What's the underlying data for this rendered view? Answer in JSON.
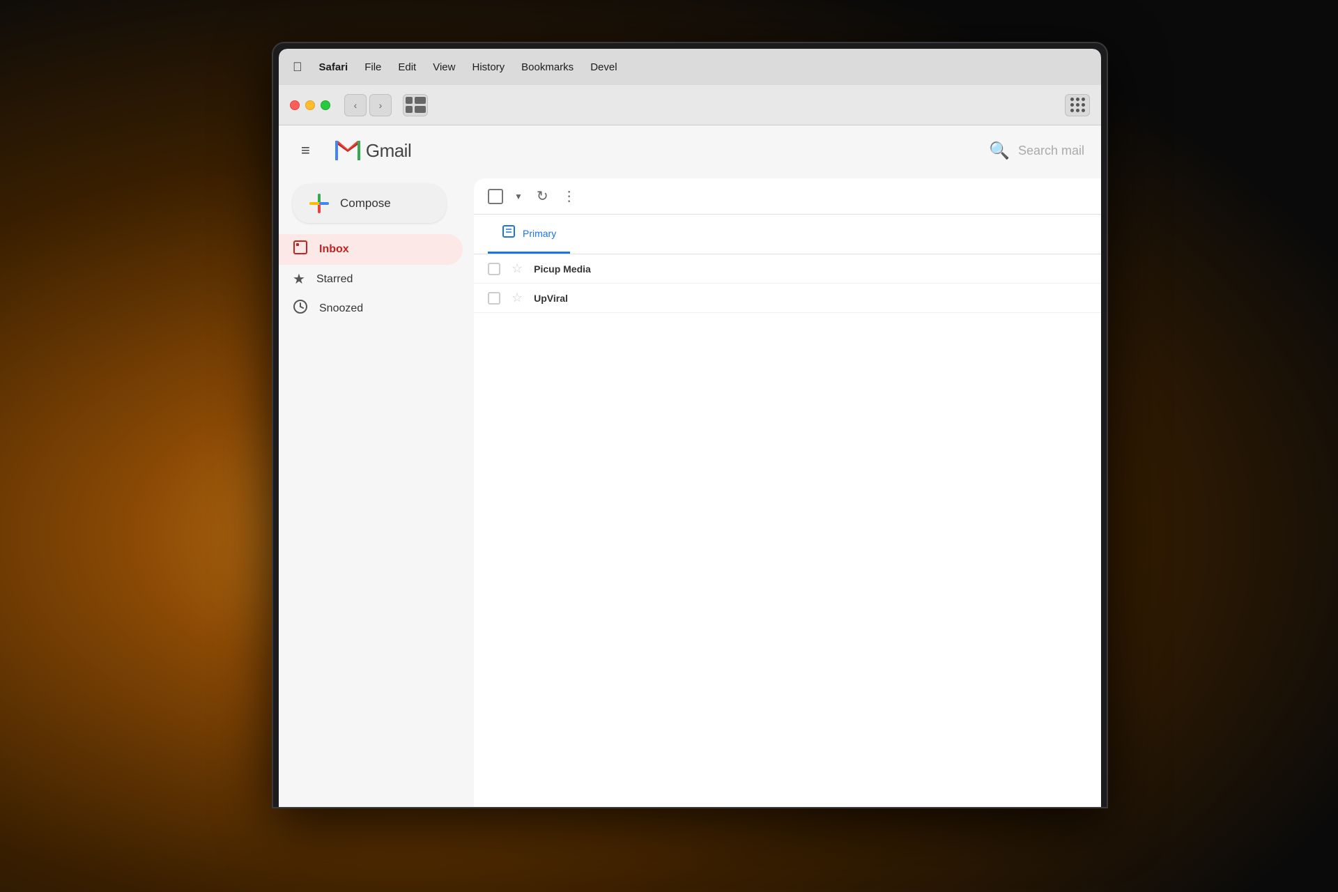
{
  "background": {
    "description": "Dark warm blurred background with light bulb glow"
  },
  "menubar": {
    "apple_symbol": "&#xF8FF;",
    "items": [
      {
        "label": "Safari",
        "bold": true
      },
      {
        "label": "File"
      },
      {
        "label": "Edit"
      },
      {
        "label": "View"
      },
      {
        "label": "History"
      },
      {
        "label": "Bookmarks"
      },
      {
        "label": "Devel"
      }
    ]
  },
  "browser": {
    "back_label": "‹",
    "forward_label": "›",
    "sidebar_label": "⊞"
  },
  "gmail": {
    "menu_icon": "≡",
    "logo_text": "Gmail",
    "search_placeholder": "Search mail",
    "compose_label": "Compose",
    "sidebar_items": [
      {
        "id": "inbox",
        "icon": "🔖",
        "label": "Inbox",
        "active": true
      },
      {
        "id": "starred",
        "icon": "★",
        "label": "Starred",
        "active": false
      },
      {
        "id": "snoozed",
        "icon": "🕐",
        "label": "Snoozed",
        "active": false
      }
    ],
    "toolbar": {
      "more_label": "⋮",
      "refresh_label": "↻"
    },
    "tabs": [
      {
        "id": "primary",
        "icon": "⬜",
        "label": "Primary",
        "active": true
      }
    ],
    "email_rows": [
      {
        "id": "1",
        "sender": "Picup Media",
        "starred": false
      },
      {
        "id": "2",
        "sender": "UpViral",
        "starred": false
      }
    ]
  }
}
